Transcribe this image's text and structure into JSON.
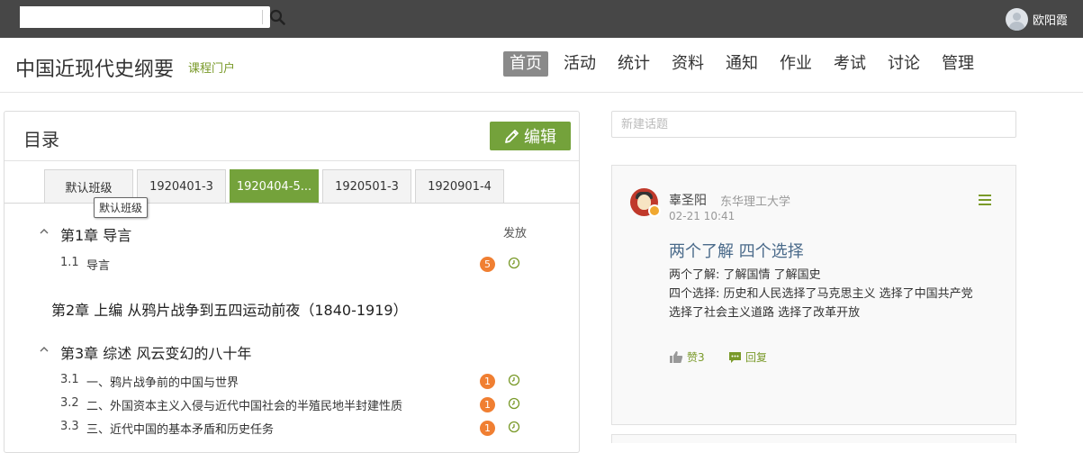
{
  "topbar": {
    "search": {
      "value": "",
      "placeholder": ""
    },
    "user": {
      "name": "欧阳霞"
    }
  },
  "header": {
    "course_title": "中国近现代史纲要",
    "course_portal": "课程门户",
    "nav": [
      "首页",
      "活动",
      "统计",
      "资料",
      "通知",
      "作业",
      "考试",
      "讨论",
      "管理"
    ],
    "active_nav": "首页"
  },
  "toc": {
    "title": "目录",
    "edit_label": "编辑",
    "tabs": [
      "默认班级",
      "1920401-3",
      "1920404-5...",
      "1920501-3",
      "1920901-4"
    ],
    "active_tab": "1920404-5...",
    "tooltip": "默认班级",
    "publish_label": "发放",
    "chapters": [
      {
        "title": "第1章 导言",
        "lessons": [
          {
            "num": "1.1",
            "title": "导言",
            "badge": "5"
          }
        ]
      },
      {
        "title": "第2章 上编 从鸦片战争到五四运动前夜（1840-1919）",
        "lessons": []
      },
      {
        "title": "第3章 综述 风云变幻的八十年",
        "lessons": [
          {
            "num": "3.1",
            "title": "一、鸦片战争前的中国与世界",
            "badge": "1"
          },
          {
            "num": "3.2",
            "title": "二、外国资本主义入侵与近代中国社会的半殖民地半封建性质",
            "badge": "1"
          },
          {
            "num": "3.3",
            "title": "三、近代中国的基本矛盾和历史任务",
            "badge": "1"
          }
        ]
      }
    ]
  },
  "discussion": {
    "new_topic_placeholder": "新建话题",
    "post": {
      "author": "辜圣阳",
      "school": "东华理工大学",
      "time": "02-21 10:41",
      "title": "两个了解 四个选择",
      "body": [
        "两个了解: 了解国情 了解国史",
        "四个选择: 历史和人民选择了马克思主义 选择了中国共产党",
        "选择了社会主义道路 选择了改革开放"
      ],
      "like_label": "赞3",
      "reply_label": "回复"
    }
  },
  "colors": {
    "topbar": "#474747",
    "accent_green": "#74a23b",
    "badge_orange": "#f07f32",
    "link_blue": "#4a6a8a"
  }
}
